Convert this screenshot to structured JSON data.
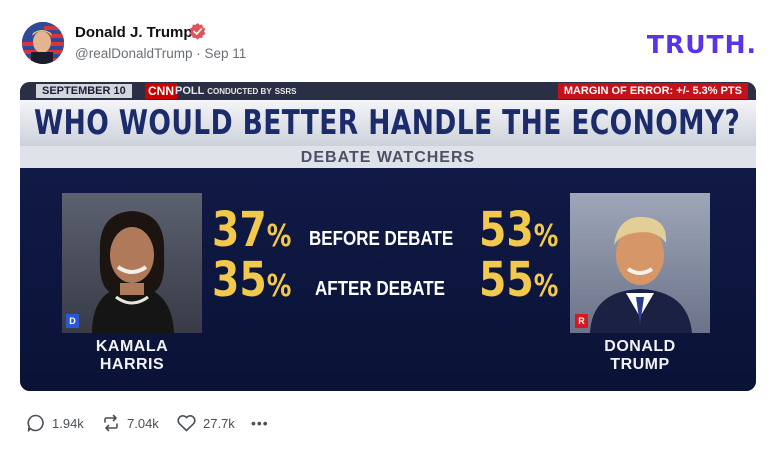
{
  "post": {
    "author": "Donald J. Trump",
    "handle": "@realDonaldTrump",
    "separator": "·",
    "date": "Sep 11",
    "brand": "TRUTH."
  },
  "media": {
    "banner": {
      "date": "SEPTEMBER 10",
      "network": "CNN",
      "poll_label": "POLL",
      "poll_conducted": "CONDUCTED BY",
      "pollster": "SSRS",
      "margin_of_error": "MARGIN OF ERROR: +/- 5.3% PTS"
    },
    "headline": "WHO WOULD BETTER HANDLE THE ECONOMY?",
    "subhead": "DEBATE WATCHERS",
    "candidates": [
      {
        "first": "KAMALA",
        "last": "HARRIS",
        "party": "D"
      },
      {
        "first": "DONALD",
        "last": "TRUMP",
        "party": "R"
      }
    ],
    "rows": [
      {
        "label": "BEFORE DEBATE",
        "harris": "37",
        "trump": "53",
        "unit": "%"
      },
      {
        "label": "AFTER DEBATE",
        "harris": "35",
        "trump": "55",
        "unit": "%"
      }
    ]
  },
  "actions": {
    "replies": "1.94k",
    "retruths": "7.04k",
    "likes": "27.7k",
    "more": "•••"
  },
  "colors": {
    "brand": "#5a35e8",
    "verified": "#e0535a",
    "headline": "#1c2c6b",
    "percent": "#f2c94c",
    "democrat": "#2b57d6",
    "republican": "#d21a22"
  }
}
